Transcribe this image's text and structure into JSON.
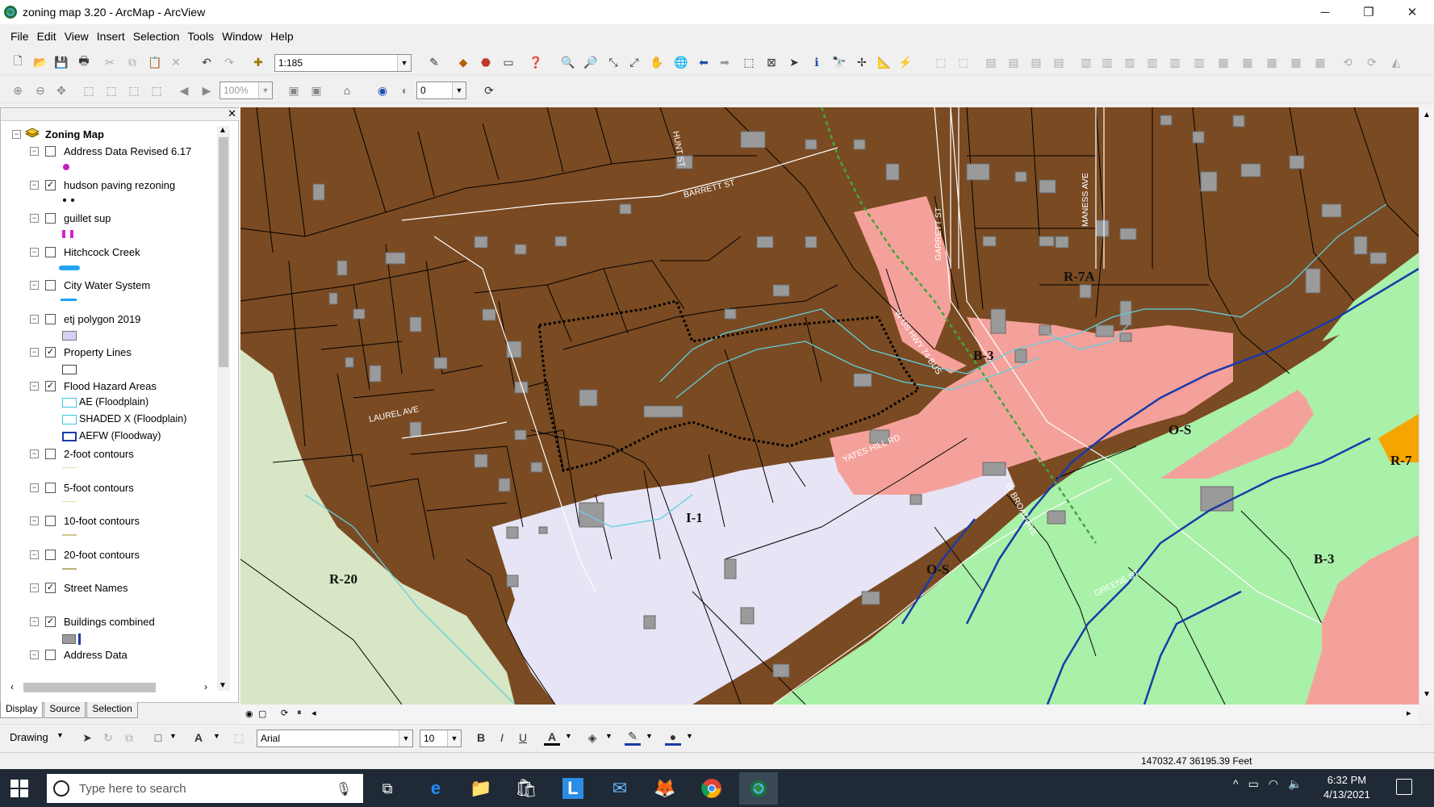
{
  "window": {
    "title": "zoning map 3.20 - ArcMap - ArcView",
    "min": "─",
    "restore": "❐",
    "close": "✕"
  },
  "menu": [
    "File",
    "Edit",
    "View",
    "Insert",
    "Selection",
    "Tools",
    "Window",
    "Help"
  ],
  "toolbar": {
    "scale": "1:185",
    "zoom_pct": "100%",
    "rotation": "0"
  },
  "toc": {
    "root": "Zoning Map",
    "layers": [
      {
        "name": "Address Data Revised 6.17",
        "checked": false
      },
      {
        "name": "hudson paving rezoning",
        "checked": true
      },
      {
        "name": "guillet sup",
        "checked": false
      },
      {
        "name": "Hitchcock Creek",
        "checked": false
      },
      {
        "name": "City Water System",
        "checked": false
      },
      {
        "name": "etj polygon 2019",
        "checked": false
      },
      {
        "name": "Property Lines",
        "checked": true
      },
      {
        "name": "Flood Hazard Areas",
        "checked": true
      },
      {
        "name": "2-foot contours",
        "checked": false
      },
      {
        "name": "5-foot contours",
        "checked": false
      },
      {
        "name": "10-foot contours",
        "checked": false
      },
      {
        "name": "20-foot contours",
        "checked": false
      },
      {
        "name": "Street Names",
        "checked": true
      },
      {
        "name": "Buildings combined",
        "checked": true
      },
      {
        "name": "Address Data",
        "checked": false
      }
    ],
    "flood_classes": [
      "AE (Floodplain)",
      "SHADED X (Floodplain)",
      "AEFW (Floodway)"
    ],
    "tabs": [
      "Display",
      "Source",
      "Selection"
    ]
  },
  "map": {
    "zones": [
      "R-7A",
      "B-3",
      "O-S",
      "R-7",
      "I-1",
      "R-20",
      "O-S",
      "B-3"
    ],
    "streets": [
      "BARRETT ST",
      "LAUREL AVE",
      "W US HWY 74 BUS",
      "YATES HILL RD",
      "GARRETT ST",
      "MANESS AVE",
      "W BROAD AVE",
      "GREENE ST",
      "HUNT ST"
    ],
    "colors": {
      "residential": "#7a4a22",
      "business": "#f5a19b",
      "open_space": "#a9f0a8",
      "industrial": "#e6e4f5",
      "rural": "#d7e6c4",
      "water": "#2446b4"
    }
  },
  "drawing": {
    "label": "Drawing",
    "font": "Arial",
    "size": "10"
  },
  "status": {
    "coords": "147032.47  36195.39 Feet"
  },
  "taskbar": {
    "search_placeholder": "Type here to search",
    "time": "6:32 PM",
    "date": "4/13/2021"
  }
}
